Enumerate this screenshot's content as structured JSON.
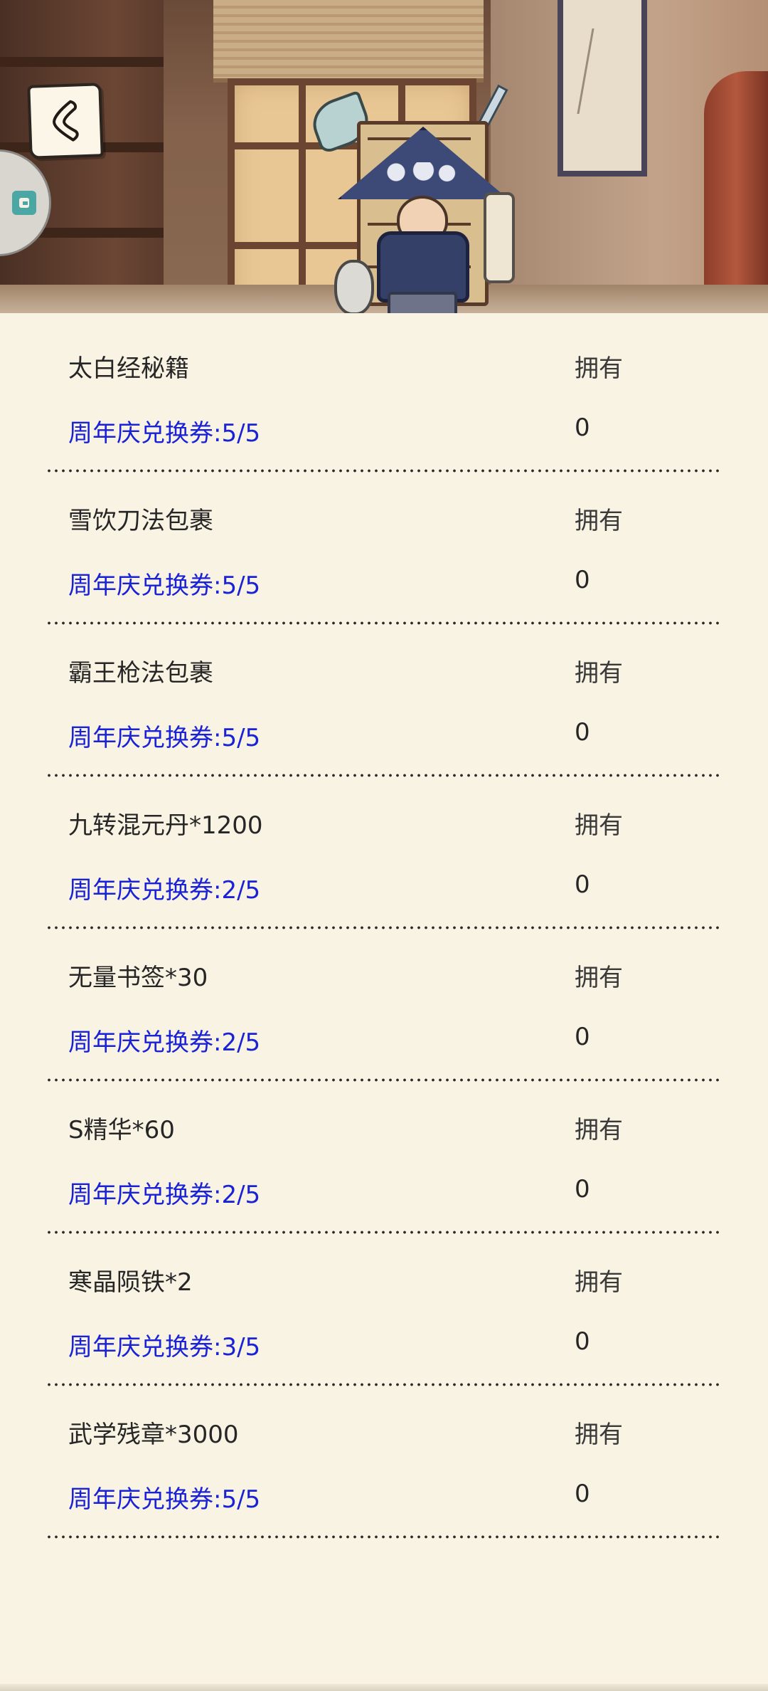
{
  "header": {
    "back_icon": "chevron-left-icon",
    "side_tab_icon": "tab-icon"
  },
  "items": [
    {
      "name": "太白经秘籍",
      "owned_label": "拥有",
      "cost": "周年庆兑换券:5/5",
      "owned_count": "0"
    },
    {
      "name": "雪饮刀法包裹",
      "owned_label": "拥有",
      "cost": "周年庆兑换券:5/5",
      "owned_count": "0"
    },
    {
      "name": "霸王枪法包裹",
      "owned_label": "拥有",
      "cost": "周年庆兑换券:5/5",
      "owned_count": "0"
    },
    {
      "name": "九转混元丹*1200",
      "owned_label": "拥有",
      "cost": "周年庆兑换券:2/5",
      "owned_count": "0"
    },
    {
      "name": "无量书签*30",
      "owned_label": "拥有",
      "cost": "周年庆兑换券:2/5",
      "owned_count": "0"
    },
    {
      "name": "S精华*60",
      "owned_label": "拥有",
      "cost": "周年庆兑换券:2/5",
      "owned_count": "0"
    },
    {
      "name": "寒晶陨铁*2",
      "owned_label": "拥有",
      "cost": "周年庆兑换券:3/5",
      "owned_count": "0"
    },
    {
      "name": "武学残章*3000",
      "owned_label": "拥有",
      "cost": "周年庆兑换券:5/5",
      "owned_count": "0"
    }
  ],
  "colors": {
    "background": "#f9f3e3",
    "cost_text": "#1a22d6",
    "primary_text": "#262626"
  }
}
